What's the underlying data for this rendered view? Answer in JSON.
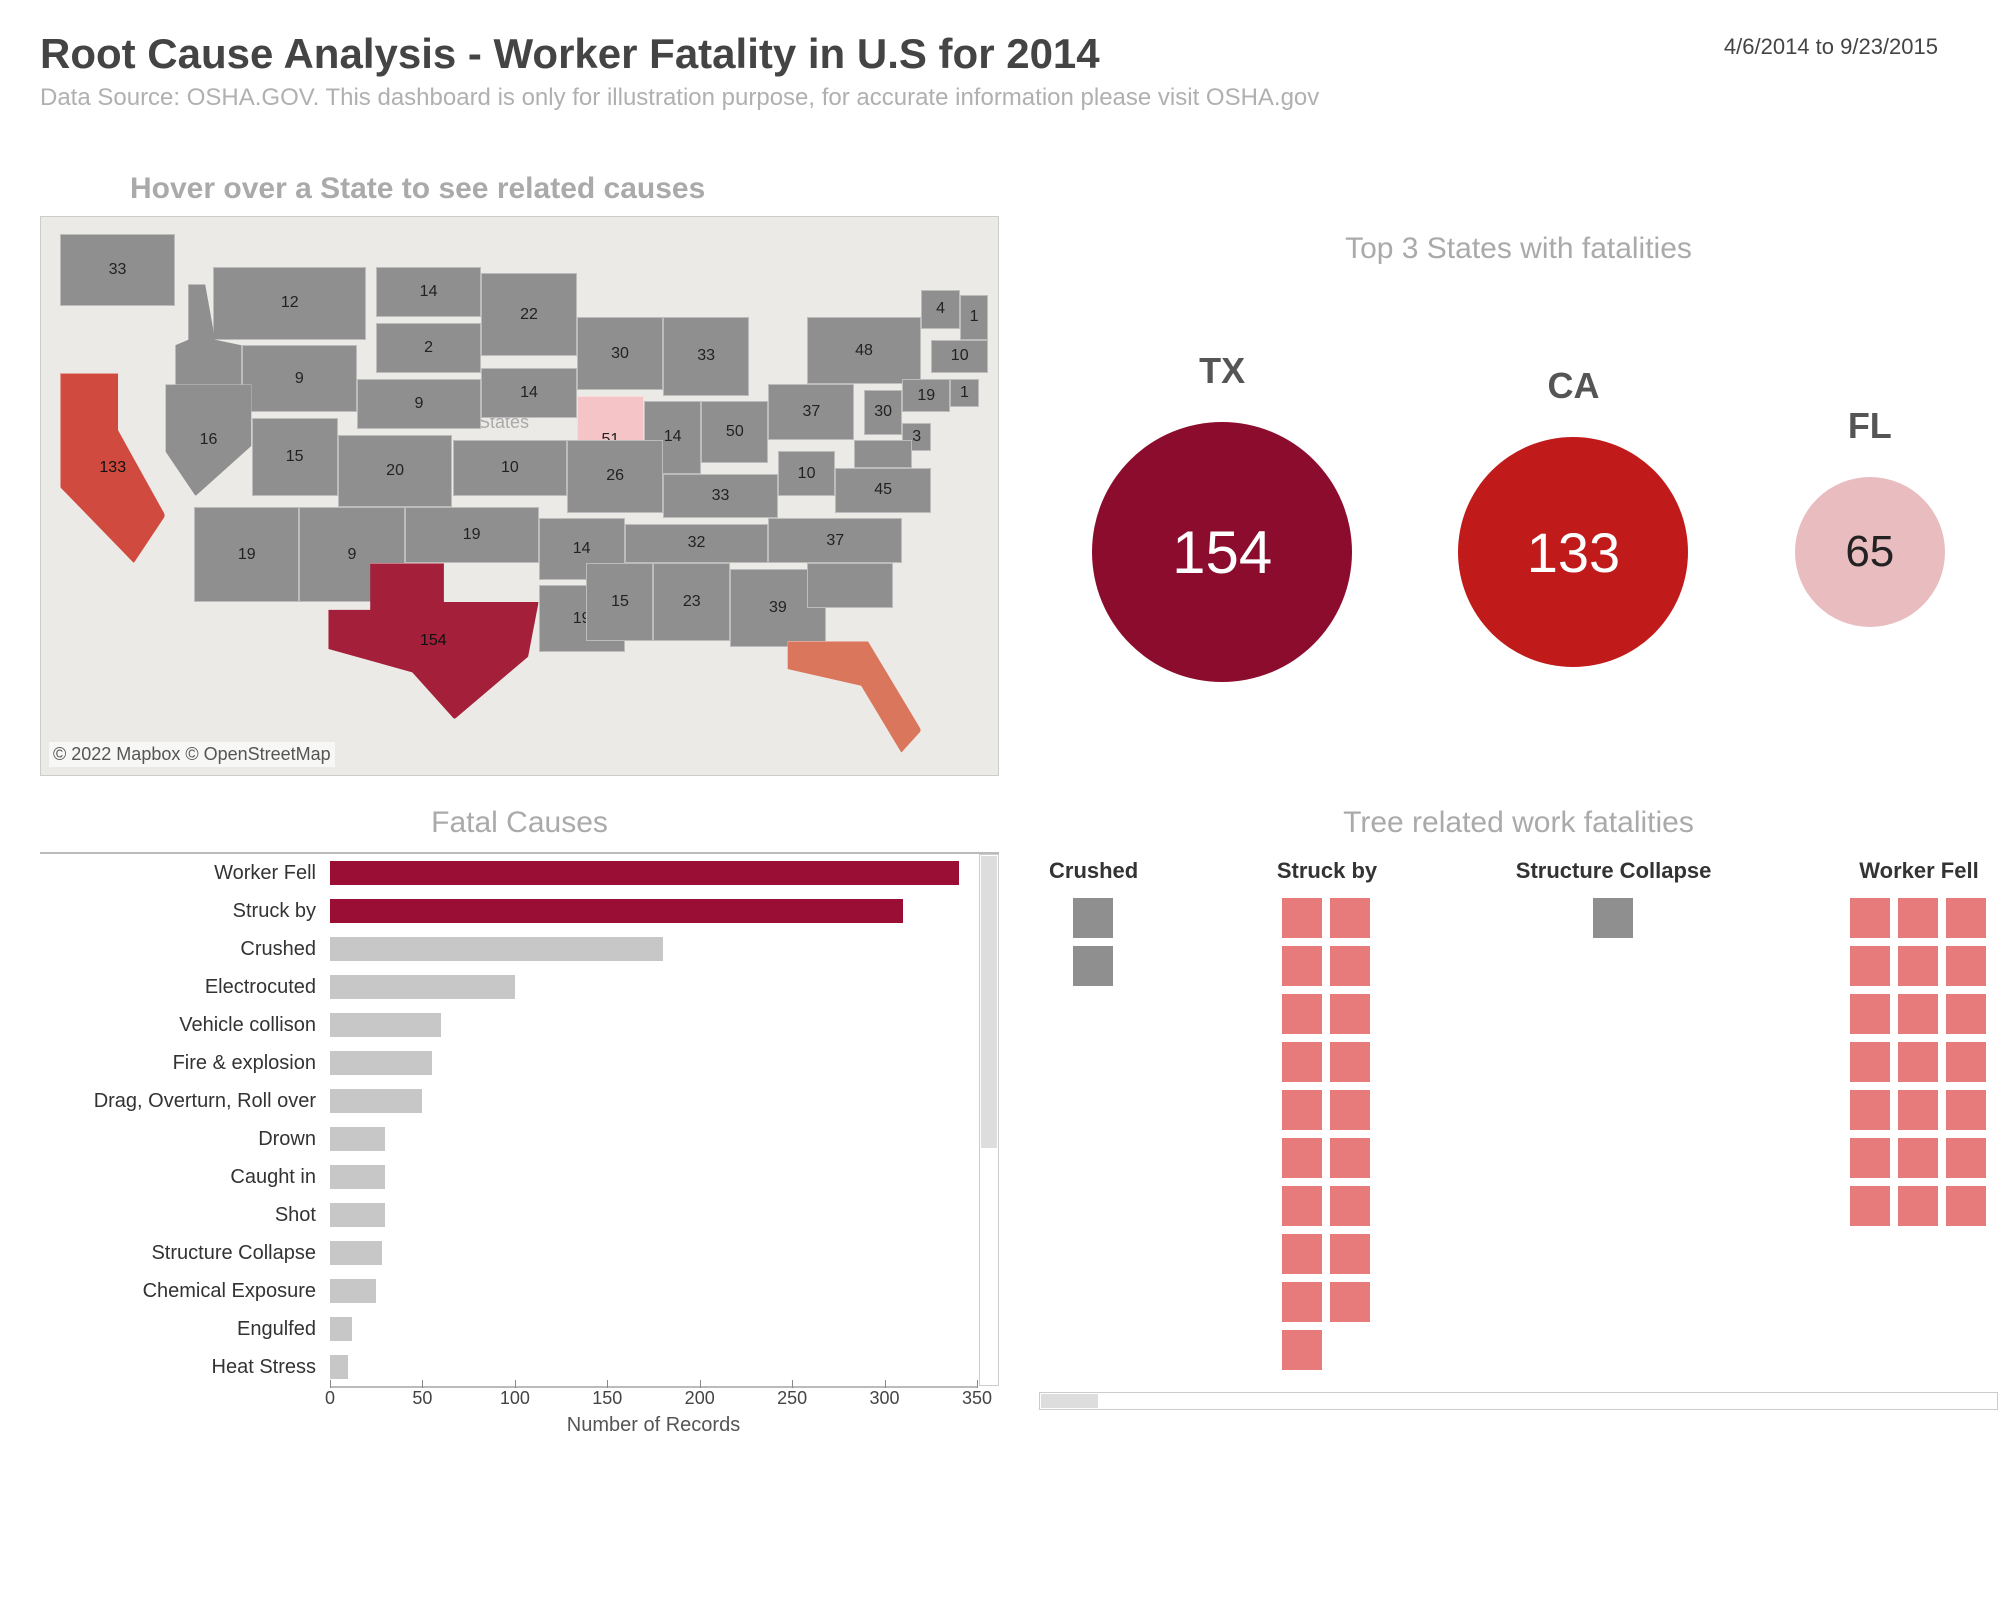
{
  "header": {
    "title": "Root Cause Analysis - Worker Fatality in U.S for 2014",
    "subtitle": "Data Source: OSHA.GOV. This dashboard is only for illustration purpose, for accurate information please visit OSHA.gov",
    "date_range": "4/6/2014 to 9/23/2015"
  },
  "map": {
    "title": "Hover over a State to see related causes",
    "attribution": "© 2022 Mapbox © OpenStreetMap",
    "center_label": "United States",
    "states": [
      {
        "abbr": "WA",
        "val": 33
      },
      {
        "abbr": "MT",
        "val": 12
      },
      {
        "abbr": "ND",
        "val": 14
      },
      {
        "abbr": "MN",
        "val": 22
      },
      {
        "abbr": "SD",
        "val": 2
      },
      {
        "abbr": "WI",
        "val": 30
      },
      {
        "abbr": "MI",
        "val": 33
      },
      {
        "abbr": "NY",
        "val": 48
      },
      {
        "abbr": "VT",
        "val": 4
      },
      {
        "abbr": "NH",
        "val": 1
      },
      {
        "abbr": "MA",
        "val": 10
      },
      {
        "abbr": "ID",
        "val": null
      },
      {
        "abbr": "WY",
        "val": 9
      },
      {
        "abbr": "NE",
        "val": 9
      },
      {
        "abbr": "IA",
        "val": 14
      },
      {
        "abbr": "IL",
        "val": 51
      },
      {
        "abbr": "IN",
        "val": 14
      },
      {
        "abbr": "OH",
        "val": 50
      },
      {
        "abbr": "PA",
        "val": 37
      },
      {
        "abbr": "NJ",
        "val": 30
      },
      {
        "abbr": "CT",
        "val": 19
      },
      {
        "abbr": "RI",
        "val": 1
      },
      {
        "abbr": "DE",
        "val": 3
      },
      {
        "abbr": "CA",
        "val": 133
      },
      {
        "abbr": "NV",
        "val": 16
      },
      {
        "abbr": "UT",
        "val": 15
      },
      {
        "abbr": "CO",
        "val": 20
      },
      {
        "abbr": "KS",
        "val": 10
      },
      {
        "abbr": "MO",
        "val": 26
      },
      {
        "abbr": "KY",
        "val": 33
      },
      {
        "abbr": "WV",
        "val": 10
      },
      {
        "abbr": "VA",
        "val": 45
      },
      {
        "abbr": "MD",
        "val": null
      },
      {
        "abbr": "AZ",
        "val": 19
      },
      {
        "abbr": "NM",
        "val": 9
      },
      {
        "abbr": "OK",
        "val": 19
      },
      {
        "abbr": "AR",
        "val": 14
      },
      {
        "abbr": "TN",
        "val": 32
      },
      {
        "abbr": "NC",
        "val": 37
      },
      {
        "abbr": "TX",
        "val": 154
      },
      {
        "abbr": "LA",
        "val": 19
      },
      {
        "abbr": "MS",
        "val": 15
      },
      {
        "abbr": "AL",
        "val": 23
      },
      {
        "abbr": "GA",
        "val": 39
      },
      {
        "abbr": "SC",
        "val": null
      },
      {
        "abbr": "FL",
        "val": 65
      }
    ]
  },
  "top3": {
    "title": "Top 3 States with fatalities",
    "items": [
      {
        "label": "TX",
        "value": 154,
        "color": "#8b0c2d",
        "text": "#ffffff"
      },
      {
        "label": "CA",
        "value": 133,
        "color": "#c11a1a",
        "text": "#ffffff"
      },
      {
        "label": "FL",
        "value": 65,
        "color": "#e9bcbf",
        "text": "#222222"
      }
    ]
  },
  "fatal_causes": {
    "title": "Fatal Causes",
    "x_axis_label": "Number of Records",
    "x_ticks": [
      0,
      50,
      100,
      150,
      200,
      250,
      300,
      350
    ],
    "xmax": 350
  },
  "tree": {
    "title": "Tree related work fatalities",
    "columns": [
      {
        "label": "Crushed",
        "count": 2,
        "highlight": false,
        "cols": 1
      },
      {
        "label": "Struck by",
        "count": 19,
        "highlight": true,
        "cols": 2
      },
      {
        "label": "Structure Collapse",
        "count": 1,
        "highlight": false,
        "cols": 1
      },
      {
        "label": "Worker Fell",
        "count": 21,
        "highlight": true,
        "cols": 3
      }
    ]
  },
  "chart_data": {
    "type": "bar",
    "title": "Fatal Causes",
    "xlabel": "Number of Records",
    "ylabel": "",
    "xlim": [
      0,
      350
    ],
    "categories": [
      "Worker Fell",
      "Struck by",
      "Crushed",
      "Electrocuted",
      "Vehicle collison",
      "Fire & explosion",
      "Drag, Overturn, Roll over",
      "Drown",
      "Caught in",
      "Shot",
      "Structure Collapse",
      "Chemical Exposure",
      "Engulfed",
      "Heat Stress"
    ],
    "values": [
      340,
      310,
      180,
      100,
      60,
      55,
      50,
      30,
      30,
      30,
      28,
      25,
      12,
      10
    ],
    "highlighted": [
      "Worker Fell",
      "Struck by"
    ]
  }
}
